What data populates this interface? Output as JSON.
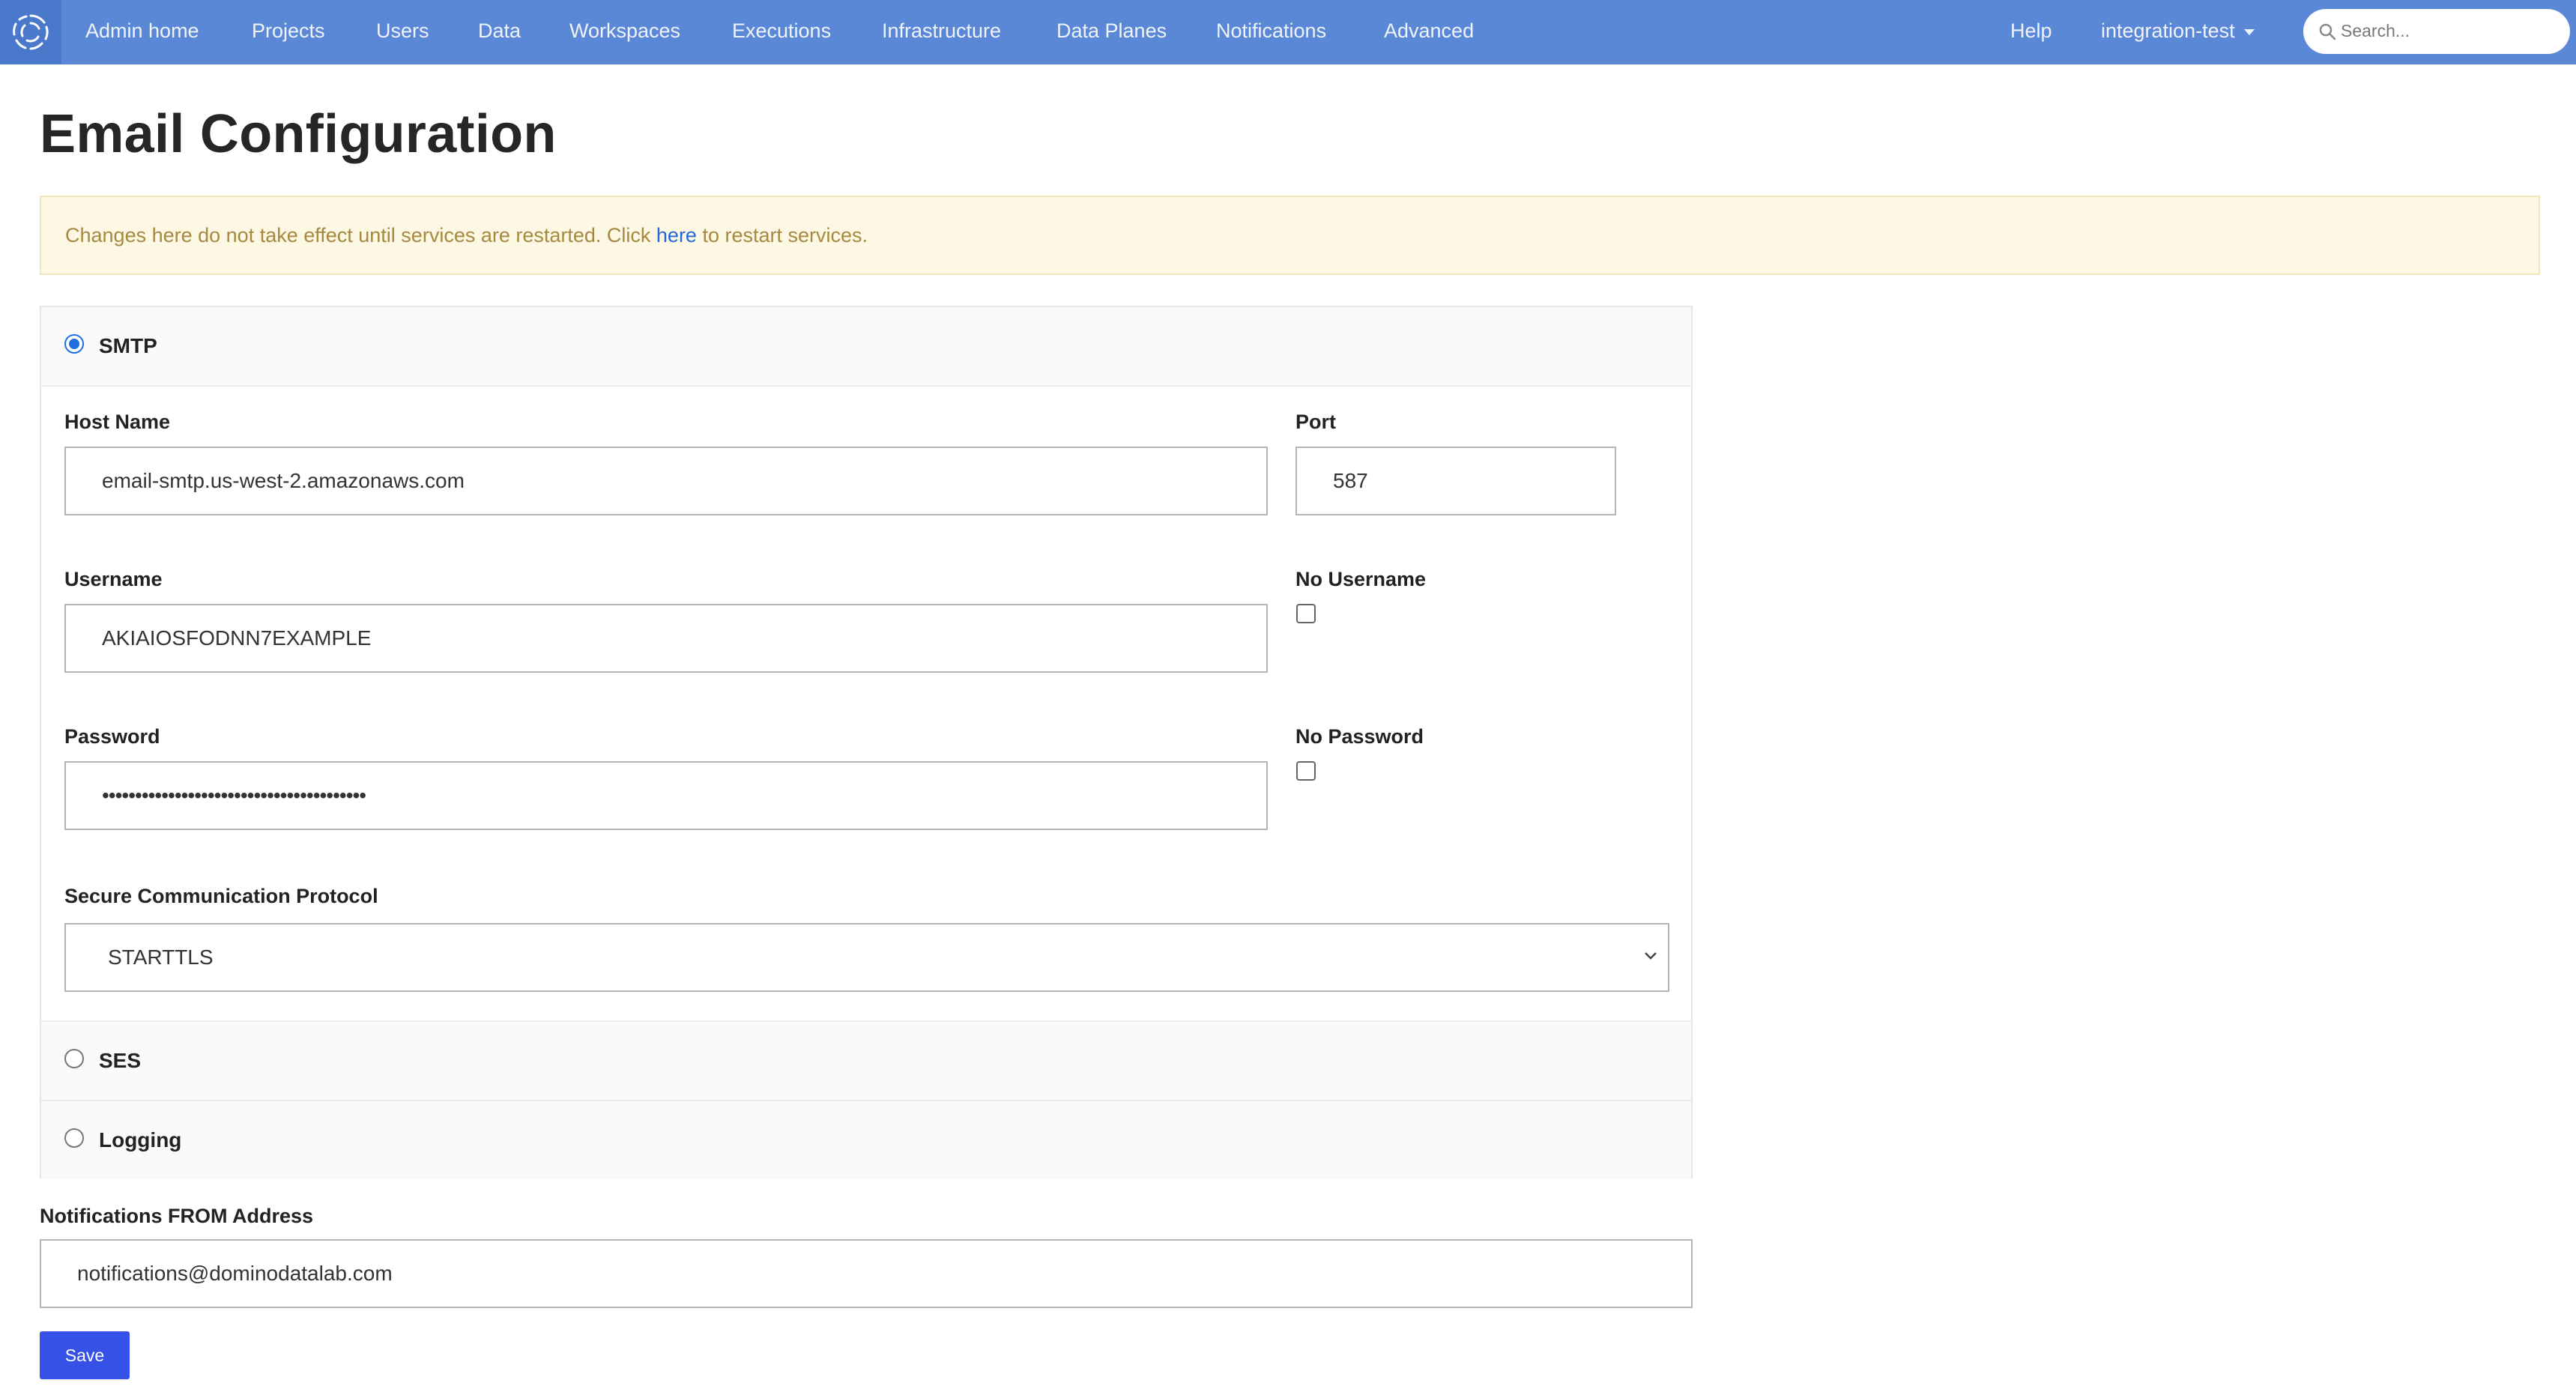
{
  "nav": {
    "items": [
      "Admin home",
      "Projects",
      "Users",
      "Data",
      "Workspaces",
      "Executions",
      "Infrastructure",
      "Data Planes",
      "Notifications",
      "Advanced"
    ],
    "help": "Help",
    "account": "integration-test",
    "search_placeholder": "Search...",
    "bar_color": "#5b88d6"
  },
  "page": {
    "title": "Email Configuration"
  },
  "alert": {
    "text_before": "Changes here do not take effect until services are restarted. Click ",
    "link": "here",
    "text_after": " to restart services."
  },
  "providers": {
    "smtp": {
      "label": "SMTP",
      "selected": true
    },
    "ses": {
      "label": "SES",
      "selected": false
    },
    "logging": {
      "label": "Logging",
      "selected": false
    }
  },
  "smtp": {
    "host_label": "Host Name",
    "host_value": "email-smtp.us-west-2.amazonaws.com",
    "port_label": "Port",
    "port_value": "587",
    "username_label": "Username",
    "username_value": "AKIAIOSFODNN7EXAMPLE",
    "no_username_label": "No Username",
    "password_label": "Password",
    "password_value": "••••••••••••••••••••••••••••••••••••••••",
    "no_password_label": "No Password",
    "protocol_label": "Secure Communication Protocol",
    "protocol_value": "STARTTLS"
  },
  "from": {
    "label": "Notifications FROM Address",
    "value": "notifications@dominodatalab.com"
  },
  "save_label": "Save",
  "save_color": "#3651e8"
}
